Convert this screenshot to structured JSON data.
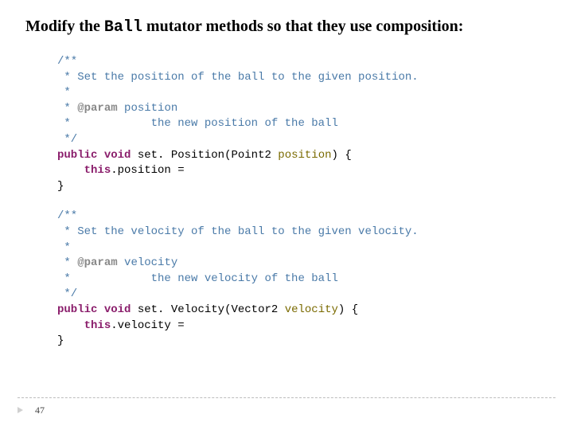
{
  "title": {
    "pre": "Modify the ",
    "mono": "Ball",
    "post": " mutator methods so that they use composition:"
  },
  "block1": {
    "doc_open": "/**",
    "doc_l1": " * Set the position of the ball to the given position.",
    "doc_l2": " *",
    "doc_l3_star": " * ",
    "doc_l3_tag": "@param",
    "doc_l3_rest": " position",
    "doc_l4": " *            the new position of the ball",
    "doc_close": " */",
    "kw_public": "public",
    "kw_void": "void",
    "method": "set. Position",
    "paren_open": "(",
    "param_type": "Point2",
    "param_name": "position",
    "paren_close": ")",
    "brace_open": " {",
    "body_indent": "    ",
    "this": "this",
    "dot": ".",
    "field": "position",
    "eq": " =",
    "brace_close": "}"
  },
  "block2": {
    "doc_open": "/**",
    "doc_l1": " * Set the velocity of the ball to the given velocity.",
    "doc_l2": " *",
    "doc_l3_star": " * ",
    "doc_l3_tag": "@param",
    "doc_l3_rest": " velocity",
    "doc_l4": " *            the new velocity of the ball",
    "doc_close": " */",
    "kw_public": "public",
    "kw_void": "void",
    "method": "set. Velocity",
    "paren_open": "(",
    "param_type": "Vector2",
    "param_name": "velocity",
    "paren_close": ")",
    "brace_open": " {",
    "body_indent": "    ",
    "this": "this",
    "dot": ".",
    "field": "velocity",
    "eq": " =",
    "brace_close": "}"
  },
  "page": "47"
}
